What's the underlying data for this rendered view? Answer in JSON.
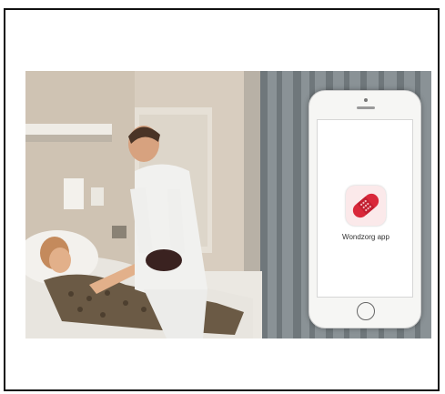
{
  "phone": {
    "app": {
      "icon": "bandage-icon",
      "label": "Wondzorg app",
      "icon_color": "#d9283a"
    }
  },
  "photo": {
    "description_colors": {
      "wall": "#d9d0c4",
      "curtain": "#7c8487",
      "uniform": "#f2f2f2"
    }
  }
}
